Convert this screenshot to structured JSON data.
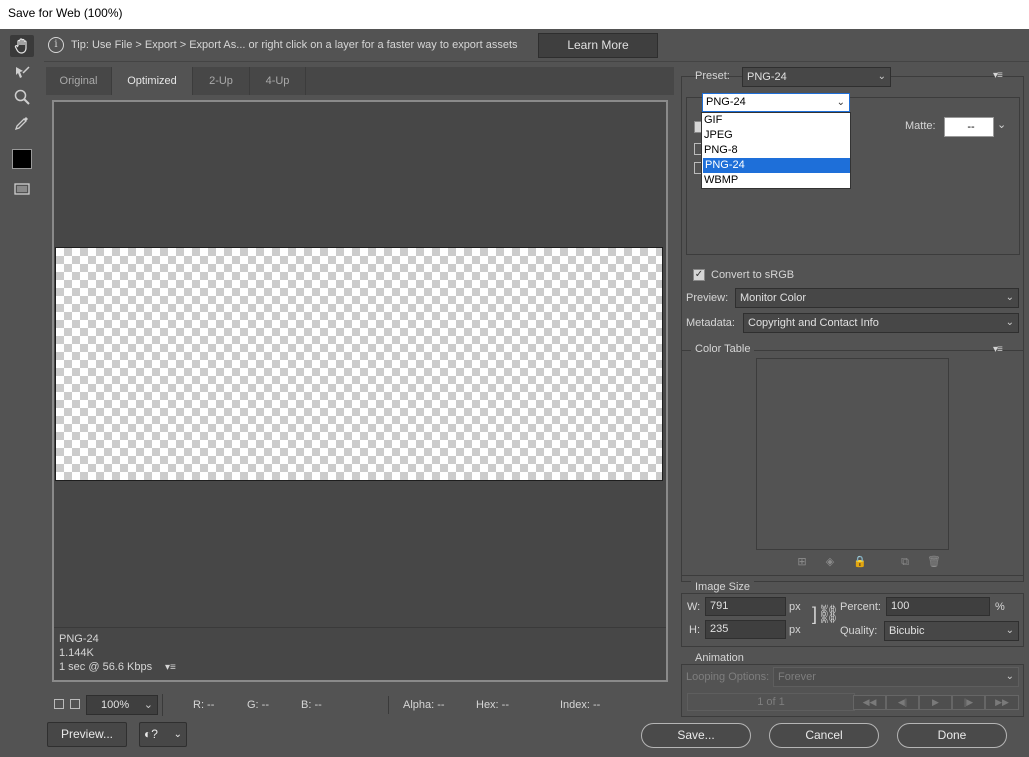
{
  "window": {
    "title": "Save for Web (100%)"
  },
  "tools": [
    {
      "name": "hand-tool",
      "icon": "hand-icon"
    },
    {
      "name": "slice-select-tool",
      "icon": "slice-select-icon"
    },
    {
      "name": "zoom-tool",
      "icon": "magnifier-icon"
    },
    {
      "name": "eyedropper-tool",
      "icon": "eyedropper-icon"
    },
    {
      "name": "eyedropper-color",
      "icon": "color-swatch",
      "color": "#000000"
    },
    {
      "name": "toggle-slices",
      "icon": "slices-visibility-icon"
    }
  ],
  "tip": {
    "text": "Tip: Use File > Export > Export As...  or right click on a layer for a faster way to export assets",
    "learn_more": "Learn More"
  },
  "tabs": [
    {
      "label": "Original",
      "active": false
    },
    {
      "label": "Optimized",
      "active": true
    },
    {
      "label": "2-Up",
      "active": false
    },
    {
      "label": "4-Up",
      "active": false
    }
  ],
  "preview_info": {
    "format": "PNG-24",
    "size": "1.144K",
    "download_time": "1 sec @ 56.6 Kbps"
  },
  "status": {
    "zoom": "100%",
    "r": "R: --",
    "g": "G: --",
    "b": "B: --",
    "alpha": "Alpha: --",
    "hex": "Hex: --",
    "index": "Index: --"
  },
  "buttons": {
    "preview": "Preview...",
    "save": "Save...",
    "cancel": "Cancel",
    "done": "Done"
  },
  "settings": {
    "preset_label": "Preset:",
    "preset_value": "PNG-24",
    "format_value": "PNG-24",
    "format_options": [
      "GIF",
      "JPEG",
      "PNG-8",
      "PNG-24",
      "WBMP"
    ],
    "format_selected_index": 3,
    "matte_label": "Matte:",
    "matte_value": "--",
    "convert_srgb_label": "Convert to sRGB",
    "convert_srgb_checked": true,
    "preview_label": "Preview:",
    "preview_value": "Monitor Color",
    "metadata_label": "Metadata:",
    "metadata_value": "Copyright and Contact Info"
  },
  "color_table": {
    "title": "Color Table"
  },
  "image_size": {
    "title": "Image Size",
    "w_label": "W:",
    "w_value": "791",
    "h_label": "H:",
    "h_value": "235",
    "unit": "px",
    "percent_label": "Percent:",
    "percent_value": "100",
    "percent_unit": "%",
    "quality_label": "Quality:",
    "quality_value": "Bicubic"
  },
  "animation": {
    "title": "Animation",
    "looping_label": "Looping Options:",
    "looping_value": "Forever",
    "frame_counter": "1 of 1"
  },
  "colors": {
    "accent": "#1e6fd9",
    "panel_bg": "#535353"
  }
}
